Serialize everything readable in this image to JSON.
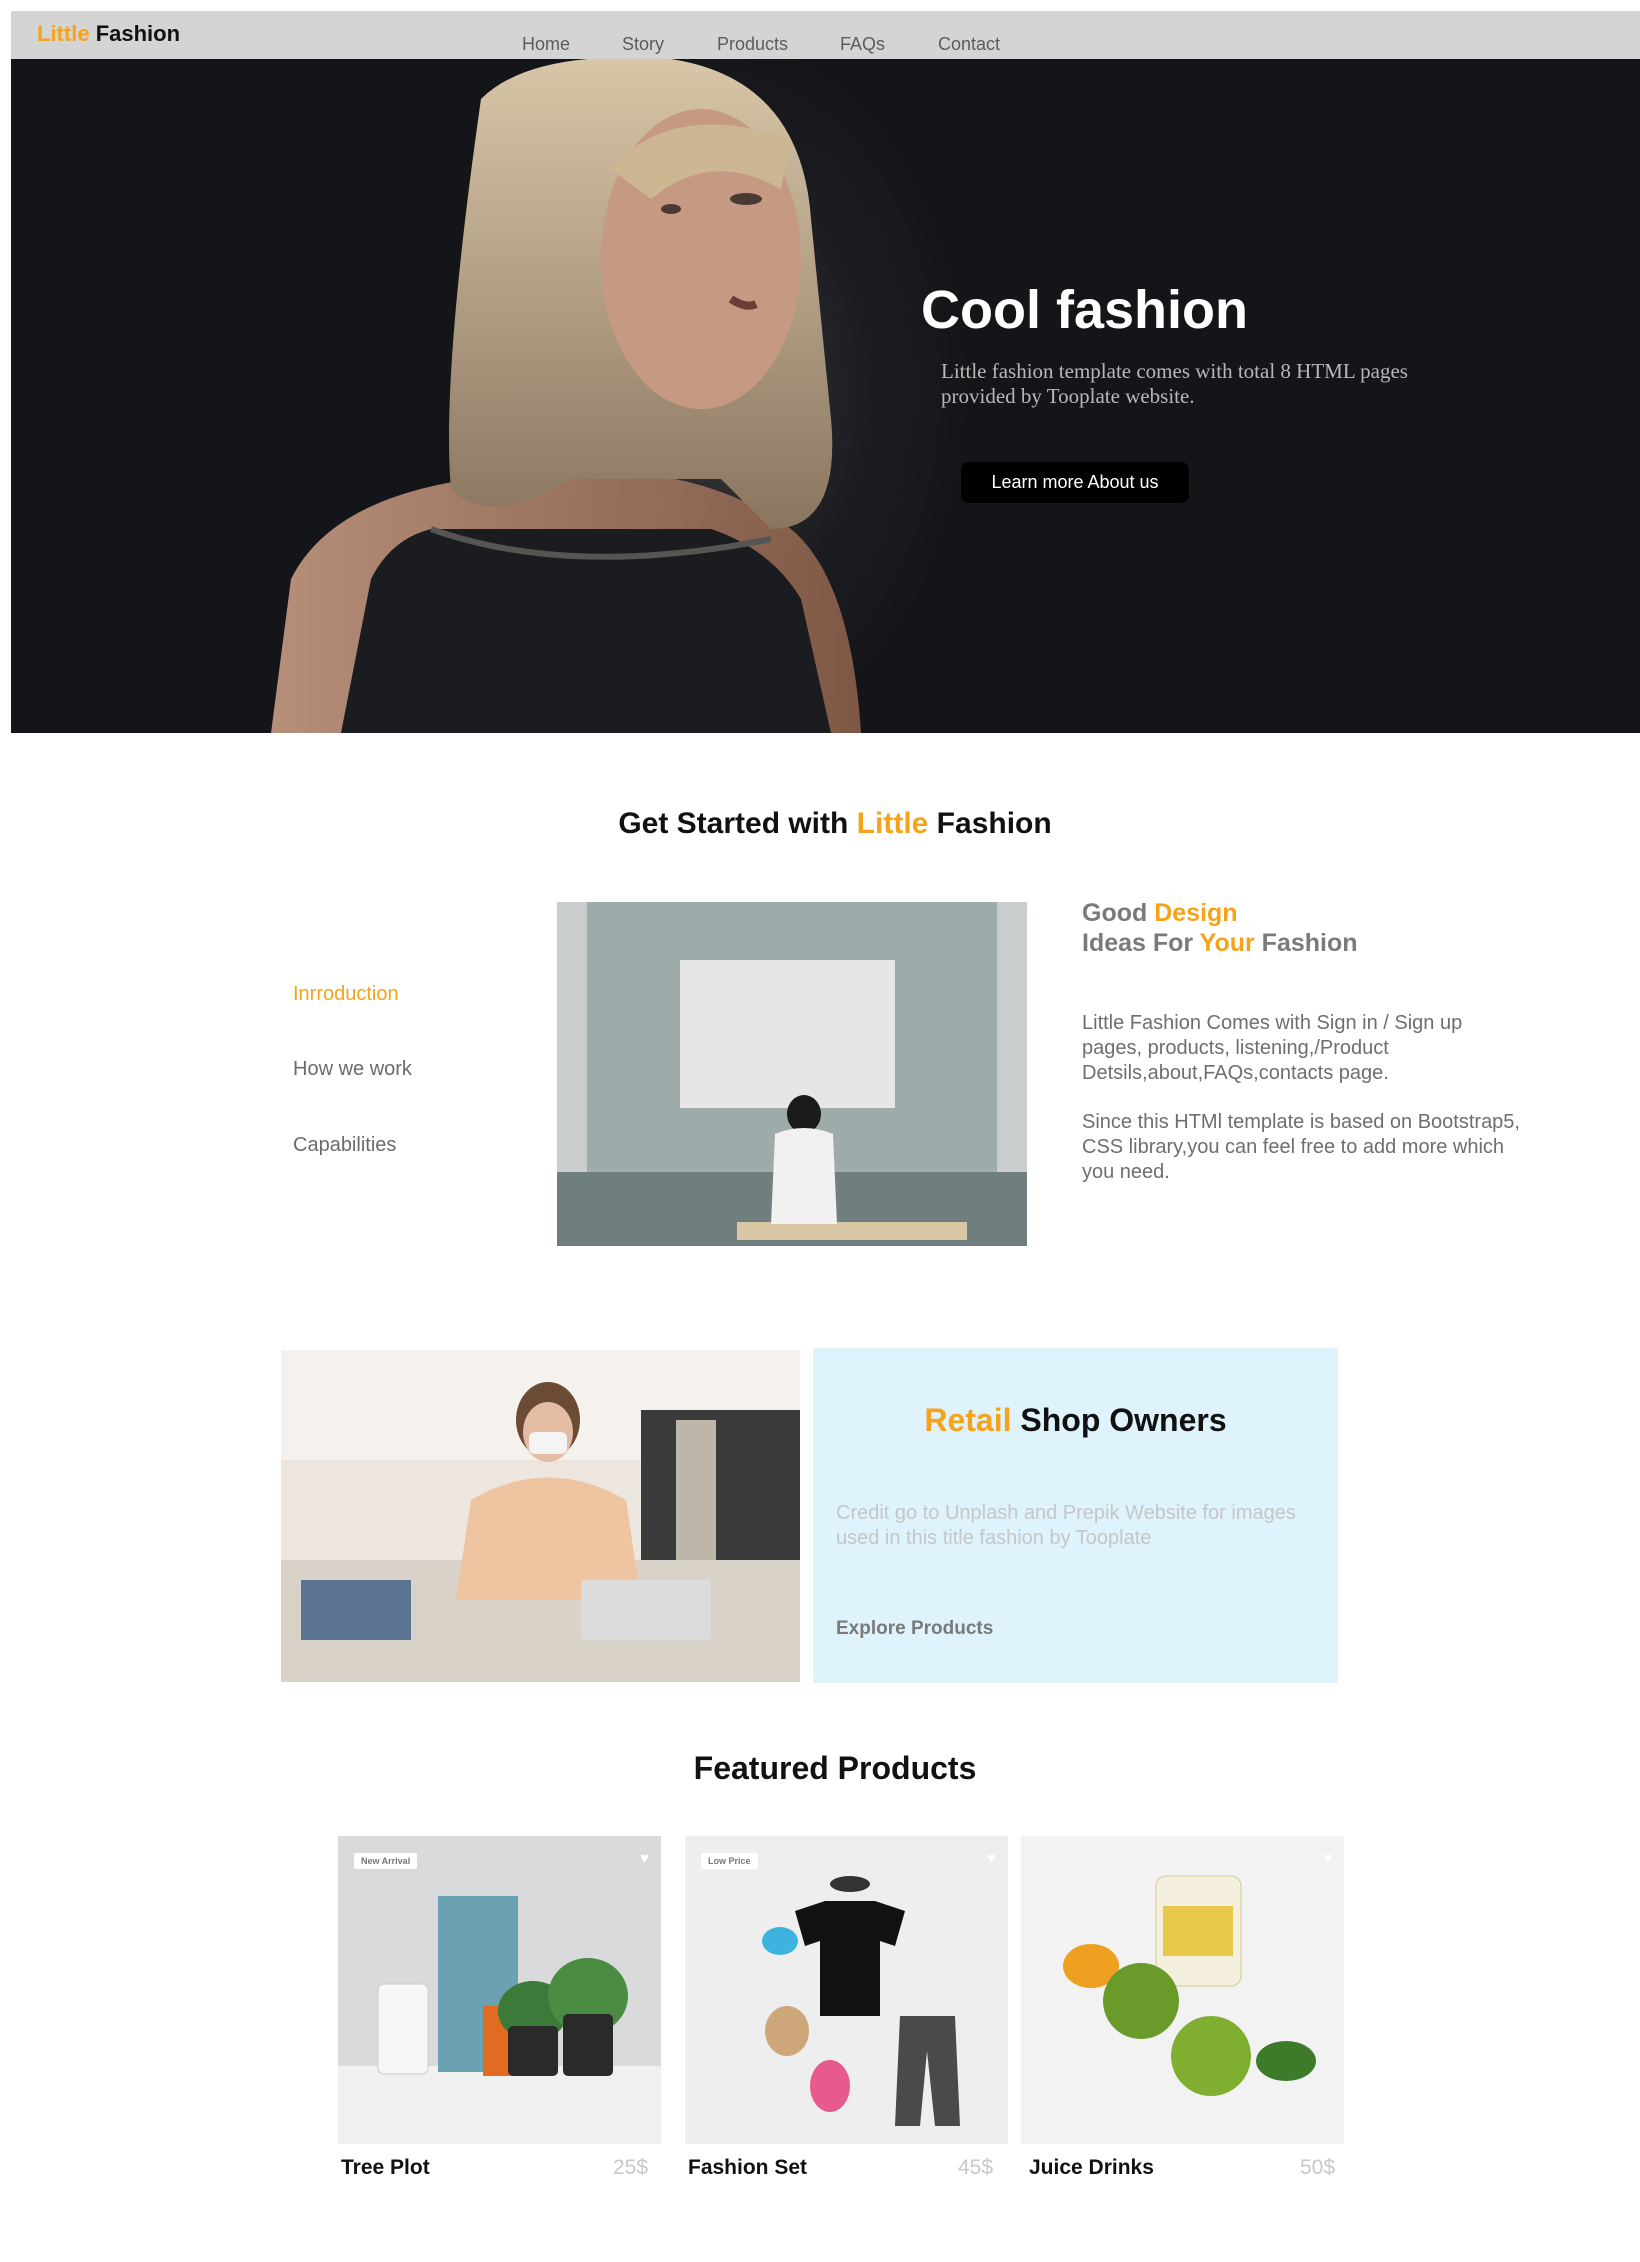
{
  "navbar": {
    "brand_accent": "Little",
    "brand_rest": "Fashion",
    "links": [
      "Home",
      "Story",
      "Products",
      "FAQs",
      "Contact"
    ]
  },
  "hero": {
    "title": "Cool fashion",
    "subtitle": "Little fashion template comes with total 8 HTML pages provided by Tooplate website.",
    "button_label": "Learn more About us"
  },
  "get_started": {
    "title_prefix": "Get Started with ",
    "title_accent": "Little",
    "title_suffix": " Fashion",
    "side_menu": [
      {
        "label": "Inrroduction",
        "active": true
      },
      {
        "label": "How we work",
        "active": false
      },
      {
        "label": "Capabilities",
        "active": false
      }
    ],
    "heading": {
      "line1_a": "Good ",
      "line1_accent": "Design",
      "line2_a": "Ideas For ",
      "line2_accent": "Your",
      "line2_b": " Fashion"
    },
    "para1": "Little Fashion Comes with Sign in / Sign up pages, products, listening,/Product Detsils,about,FAQs,contacts page.",
    "para2": "Since this HTMl template is based on Bootstrap5, CSS library,you can feel free to add more which you need."
  },
  "retail": {
    "title_accent": "Retail",
    "title_rest": " Shop Owners",
    "credit": "Credit go to Unplash and Prepik Website for images used in this title fashion by Tooplate",
    "link_label": "Explore Products"
  },
  "featured": {
    "title": "Featured Products",
    "products": [
      {
        "name": "Tree Plot",
        "price": "25$",
        "badge": "New Arrival"
      },
      {
        "name": "Fashion Set",
        "price": "45$",
        "badge": "Low Price"
      },
      {
        "name": "Juice Drinks",
        "price": "50$",
        "badge": ""
      }
    ]
  },
  "colors": {
    "accent": "#f5a31a",
    "navbar_bg": "#d4d4d4",
    "retail_bg": "#dff3fc"
  },
  "icons": {
    "heart": "heart-icon"
  }
}
